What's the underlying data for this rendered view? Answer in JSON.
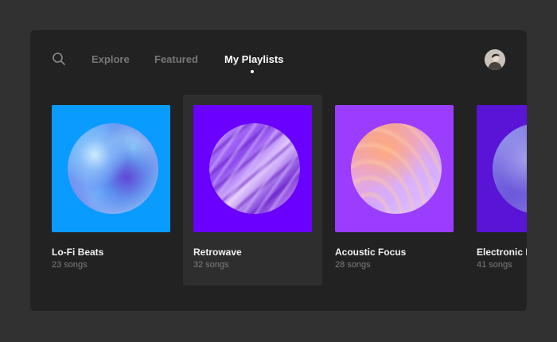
{
  "nav": {
    "tabs": [
      {
        "label": "Explore",
        "active": false
      },
      {
        "label": "Featured",
        "active": false
      },
      {
        "label": "My Playlists",
        "active": true
      }
    ]
  },
  "icons": {
    "search": "search-icon",
    "avatar": "user-avatar"
  },
  "colors": {
    "window_bg": "#222222",
    "page_bg": "#313131",
    "selected_card_bg": "#2e2e2e",
    "active_tab": "#ffffff",
    "inactive_tab": "#777777"
  },
  "playlists": [
    {
      "title": "Lo-Fi Beats",
      "count": "23 songs",
      "cover_color": "#0a9bff",
      "selected": false
    },
    {
      "title": "Retrowave",
      "count": "32 songs",
      "cover_color": "#6a00ff",
      "selected": true
    },
    {
      "title": "Acoustic Focus",
      "count": "28 songs",
      "cover_color": "#9b3dff",
      "selected": false
    },
    {
      "title": "Electronic I",
      "count": "41 songs",
      "cover_color": "#5a14d6",
      "selected": false
    }
  ]
}
